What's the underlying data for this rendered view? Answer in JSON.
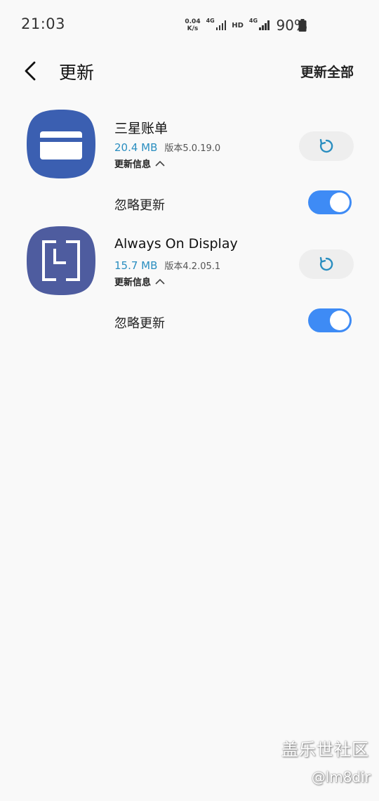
{
  "status_bar": {
    "time": "21:03",
    "net_speed_value": "0.04",
    "net_speed_unit": "K/s",
    "network_1": "4G",
    "hd": "HD",
    "network_2": "4G",
    "battery": "90%"
  },
  "header": {
    "title": "更新",
    "update_all": "更新全部"
  },
  "apps": [
    {
      "name": "三星账单",
      "size": "20.4 MB",
      "version": "版本5.0.19.0",
      "info_label": "更新信息",
      "ignore_label": "忽略更新",
      "ignore_enabled": true,
      "icon": "card-icon",
      "icon_color": "#3b5fb1"
    },
    {
      "name": "Always On Display",
      "size": "15.7 MB",
      "version": "版本4.2.05.1",
      "info_label": "更新信息",
      "ignore_label": "忽略更新",
      "ignore_enabled": true,
      "icon": "clock-frame-icon",
      "icon_color": "#4e5c9f"
    }
  ],
  "watermark": {
    "brand": "盖乐世社区",
    "user": "@lm8dir"
  },
  "colors": {
    "accent": "#3e8bf5",
    "size_text": "#2a8ec0",
    "update_icon": "#2a8ec0"
  }
}
